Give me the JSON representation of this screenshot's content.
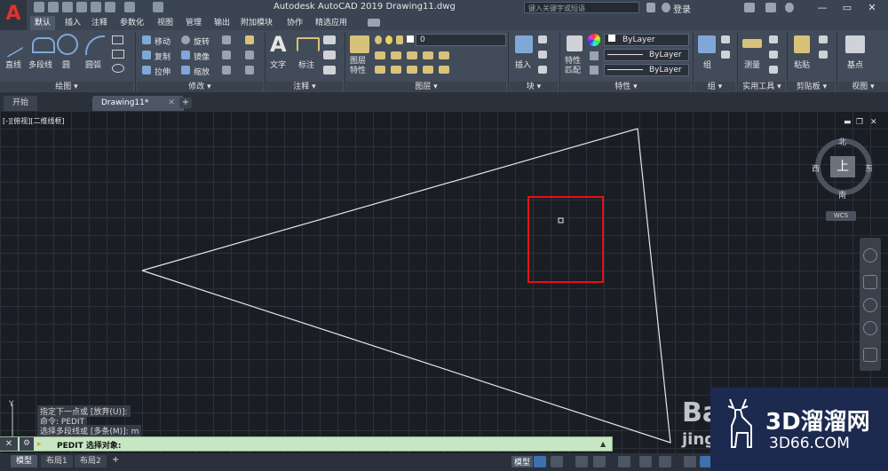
{
  "app": {
    "logo": "A",
    "title": "Autodesk AutoCAD 2019    Drawing11.dwg",
    "search_placeholder": "键入关键字或短语",
    "login": "登录",
    "window_controls": [
      "—",
      "▭",
      "✕"
    ]
  },
  "ribbon_tabs": [
    "默认",
    "插入",
    "注释",
    "参数化",
    "视图",
    "管理",
    "输出",
    "附加模块",
    "协作",
    "精选应用"
  ],
  "ribbon": {
    "draw": {
      "label": "绘图 ▾",
      "tools": [
        "直线",
        "多段线",
        "圆",
        "圆弧"
      ]
    },
    "modify": {
      "label": "修改 ▾",
      "tools": [
        "移动",
        "旋转",
        "复制",
        "镜像",
        "拉伸",
        "缩放"
      ]
    },
    "annotate": {
      "label": "注释 ▾",
      "tools": [
        "文字",
        "标注"
      ]
    },
    "layers": {
      "label": "图层 ▾",
      "tool": "图层\n特性",
      "current": "0"
    },
    "block": {
      "label": "块 ▾",
      "tool": "插入"
    },
    "properties": {
      "label": "特性 ▾",
      "tool": "特性\n匹配",
      "color": "ByLayer",
      "linetype": "ByLayer",
      "lineweight": "ByLayer"
    },
    "groups": {
      "label": "组 ▾",
      "tool": "组"
    },
    "utilities": {
      "label": "实用工具 ▾",
      "tool": "测量"
    },
    "clipboard": {
      "label": "剪贴板 ▾",
      "tool": "粘贴"
    },
    "view": {
      "label": "视图 ▾",
      "tool": "基点"
    }
  },
  "file_tabs": [
    "开始",
    "Drawing11*"
  ],
  "viewport": {
    "label": "[-][俯视][二维线框]",
    "compass": {
      "north": "北",
      "south": "南",
      "east": "东",
      "west": "西",
      "face": "上"
    },
    "wcs": "WCS"
  },
  "command": {
    "history": [
      "指定下一点或 [放弃(U)]:",
      "命令: PEDIT",
      "选择多段线或 [多条(M)]: m"
    ],
    "prompt": "PEDIT 选择对象:"
  },
  "layout_tabs": [
    "模型",
    "布局1",
    "布局2"
  ],
  "status": {
    "model": "模型"
  },
  "watermark": {
    "title": "3D溜溜网",
    "sub": "3D66.COM",
    "bai": "Ba",
    "bai2": "jing"
  },
  "colors": {
    "selection_box": "#e01414",
    "cmdline_bg": "#c7e6c3",
    "accent": "#3e6fb0"
  }
}
